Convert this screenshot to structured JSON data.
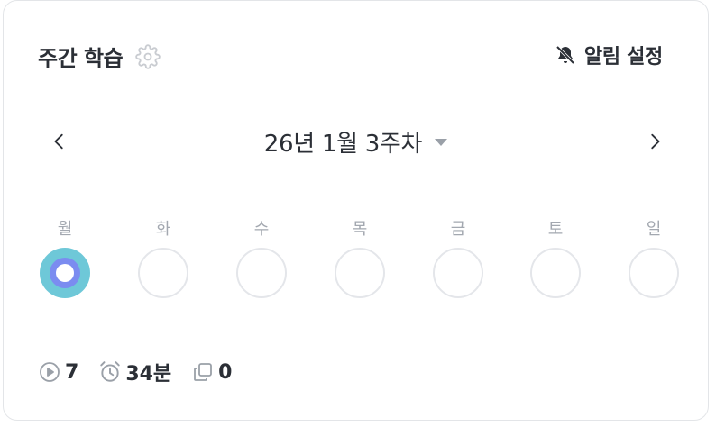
{
  "header": {
    "title": "주간 학습",
    "settings_icon": "gear-icon",
    "alarm_icon": "bell-off-icon",
    "alarm_label": "알림 설정"
  },
  "week_nav": {
    "prev_icon": "chevron-left-icon",
    "next_icon": "chevron-right-icon",
    "label": "26년 1월 3주차",
    "dropdown_icon": "caret-down-icon"
  },
  "days": [
    {
      "label": "월",
      "state": "active"
    },
    {
      "label": "화",
      "state": "empty"
    },
    {
      "label": "수",
      "state": "empty"
    },
    {
      "label": "목",
      "state": "empty"
    },
    {
      "label": "금",
      "state": "empty"
    },
    {
      "label": "토",
      "state": "empty"
    },
    {
      "label": "일",
      "state": "empty"
    }
  ],
  "stats": {
    "plays": {
      "icon": "play-circle-icon",
      "value": "7"
    },
    "time": {
      "icon": "alarm-clock-icon",
      "value": "34분"
    },
    "cards": {
      "icon": "copy-icon",
      "value": "0"
    }
  },
  "colors": {
    "active_outer": "#6ec8d8",
    "active_inner": "#7b8cf0",
    "muted": "#a3a8b0",
    "text": "#2b2f36"
  }
}
